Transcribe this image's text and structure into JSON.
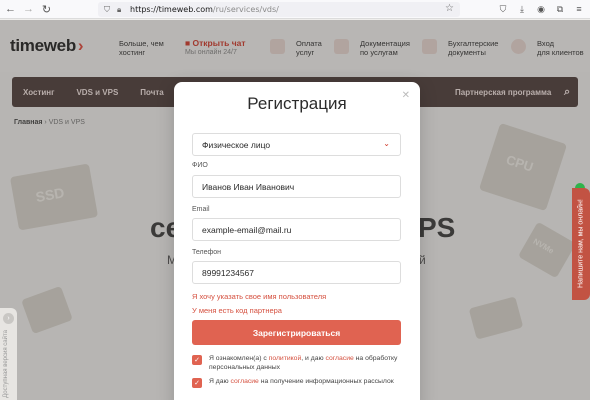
{
  "browser": {
    "url_host": "https://timeweb.com",
    "url_path": "/ru/services/vds/"
  },
  "header": {
    "logo": "timeweb",
    "tagline_line1": "Больше, чем",
    "tagline_line2": "хостинг",
    "chat": "Открыть чат",
    "chat_sub": "Мы онлайн 24/7",
    "items": [
      {
        "line1": "Оплата",
        "line2": "услуг"
      },
      {
        "line1": "Документация",
        "line2": "по услугам"
      },
      {
        "line1": "Бухгалтерские",
        "line2": "документы"
      },
      {
        "line1": "Вход",
        "line2": "для клиентов"
      }
    ]
  },
  "nav": {
    "items": [
      "Хостинг",
      "VDS и VPS",
      "Почта",
      "Партнерская программа"
    ]
  },
  "breadcrumb": {
    "home": "Главная",
    "current": "VDS и VPS"
  },
  "background": {
    "decor_labels": [
      "SSD",
      "CPU",
      "NVMe"
    ],
    "heading_fragment_left": "се",
    "heading_fragment_right": "PS",
    "sub_fragment_left": "М",
    "sub_fragment_right": "й"
  },
  "side_tab": "Напишите нам, мы онлайн!",
  "left_tab": "Доступная версия сайта",
  "modal": {
    "title": "Регистрация",
    "entity_select": "Физическое лицо",
    "fio_label": "ФИО",
    "fio_value": "Иванов Иван Иванович",
    "email_label": "Email",
    "email_value": "example-email@mail.ru",
    "phone_label": "Телефон",
    "phone_value": "89991234567",
    "username_link": "Я хочу указать свое имя пользователя",
    "partner_link": "У меня есть код партнера",
    "submit": "Зарегистрироваться",
    "agree1_pre": "Я ознакомлен(а) с",
    "agree1_link1": "политикой",
    "agree1_mid": ", и даю",
    "agree1_link2": "согласие",
    "agree1_post": "на обработку персональных данных",
    "agree2_pre": "Я даю",
    "agree2_link": "согласие",
    "agree2_post": "на получение информационных рассылок"
  },
  "colors": {
    "accent": "#e06351",
    "brand_red": "#d23a2b",
    "nav_bg": "#4e3e3b"
  }
}
